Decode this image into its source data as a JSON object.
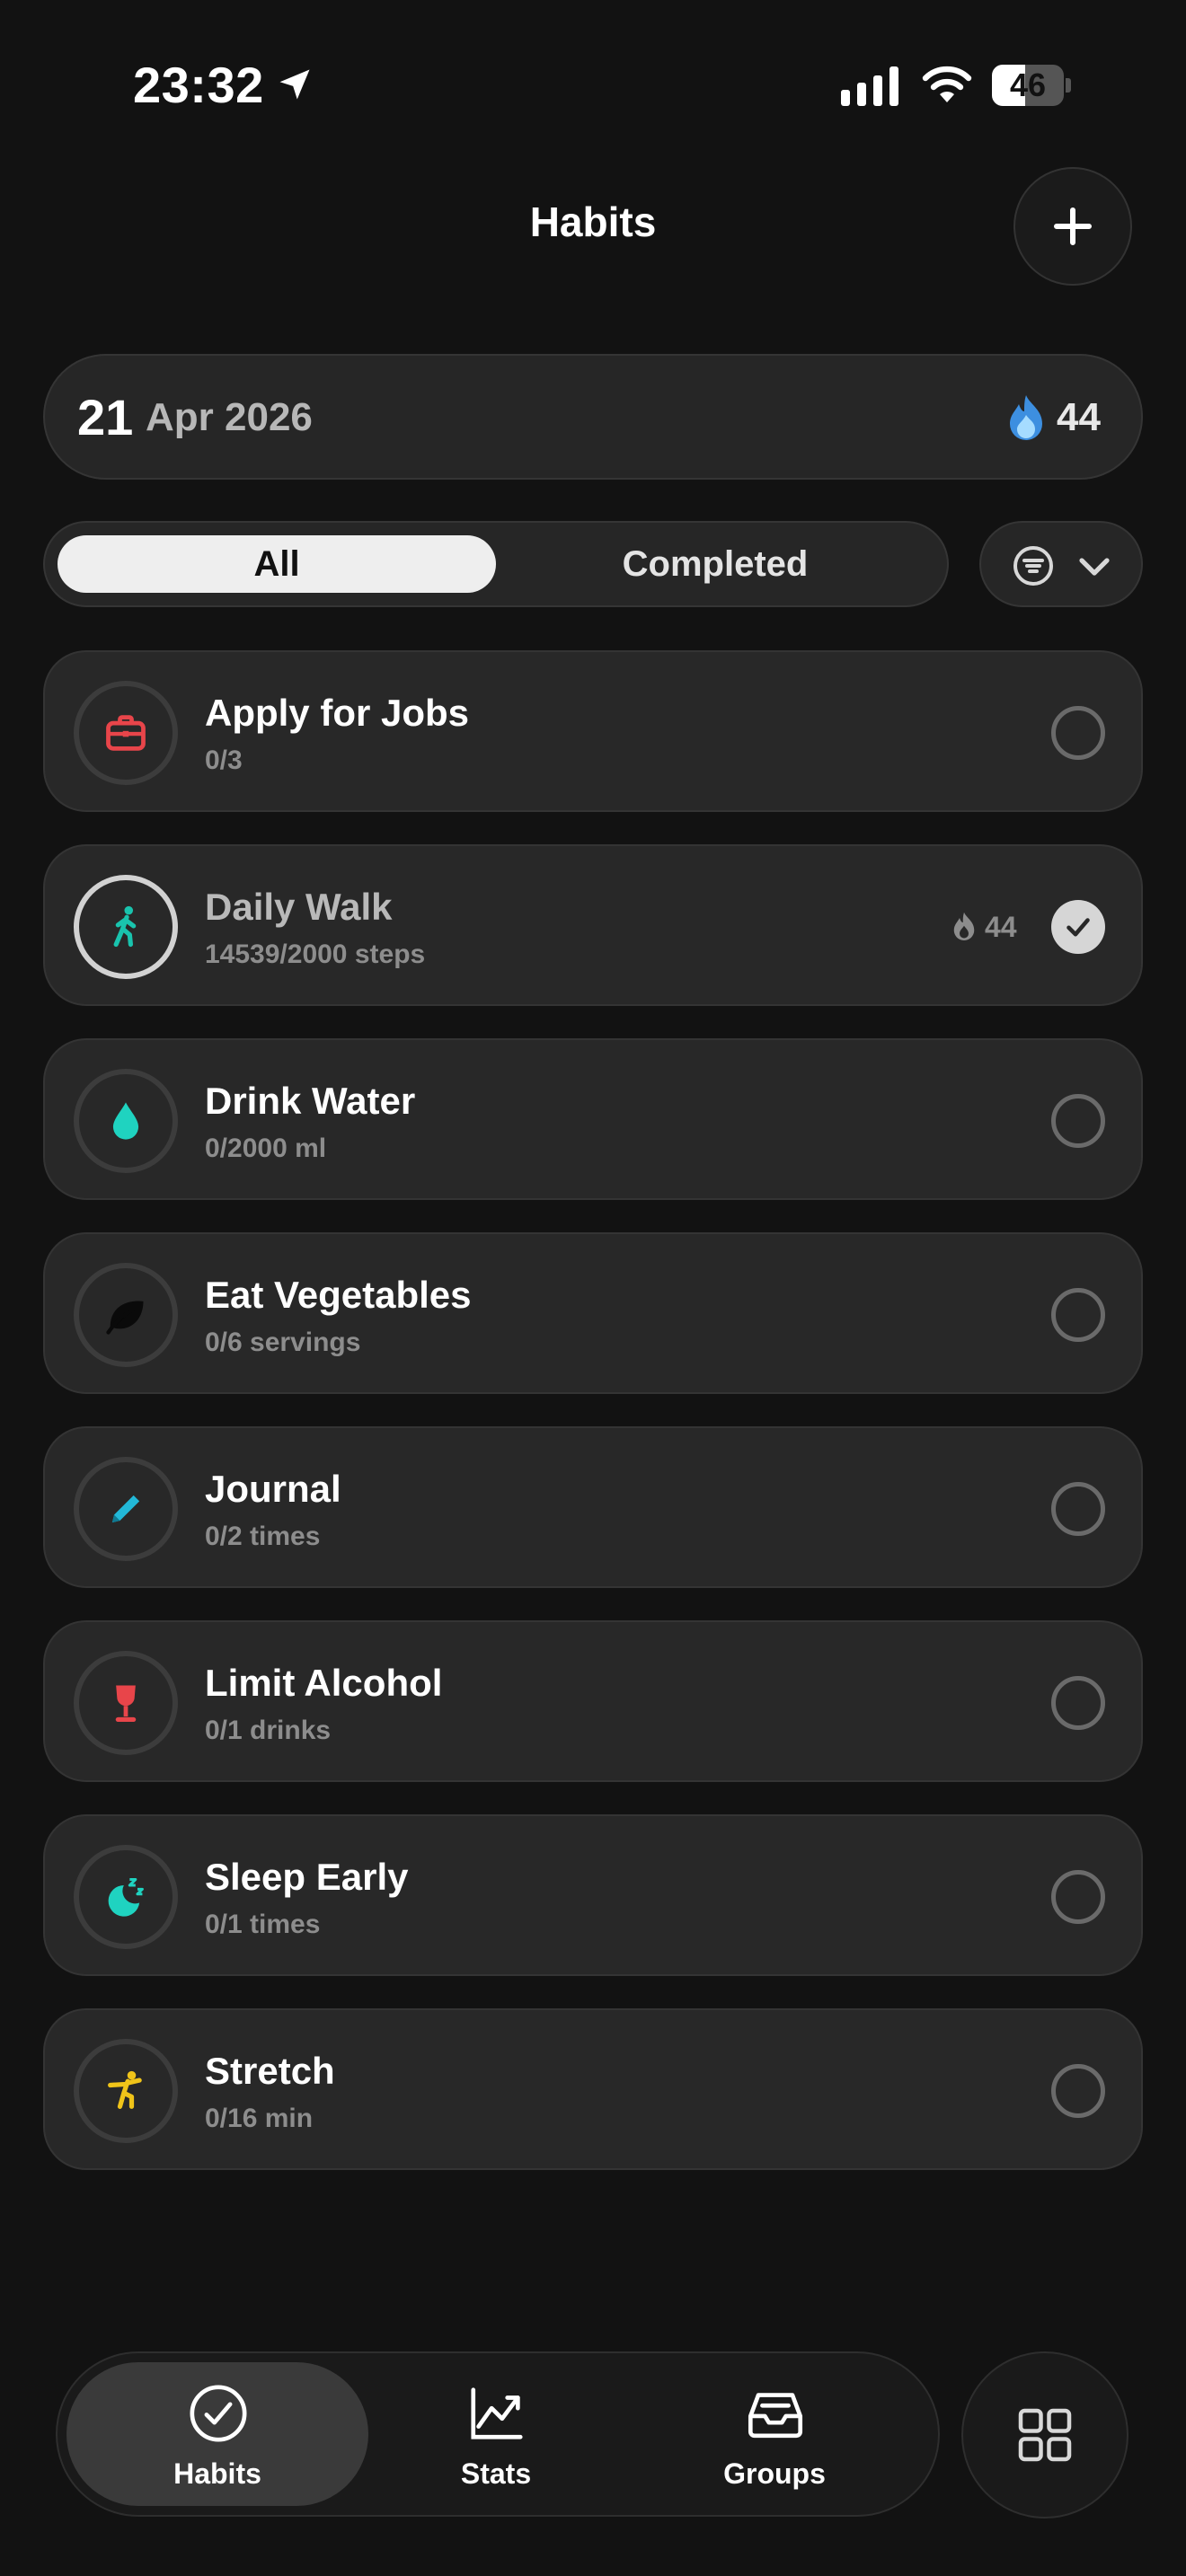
{
  "status_bar": {
    "time": "23:32",
    "battery_percent": "46",
    "battery_level": 0.46
  },
  "header": {
    "title": "Habits",
    "add_icon": "plus-icon"
  },
  "date_bar": {
    "day": "21",
    "month_year": "Apr 2026",
    "streak_icon": "flame-icon",
    "streak_count": "44"
  },
  "filter_tabs": {
    "options": [
      "All",
      "Completed"
    ],
    "selected": "All",
    "filter_icon": "filter-icon",
    "dropdown_icon": "chevron-down-icon"
  },
  "habits": [
    {
      "name": "Apply for Jobs",
      "progress": "0/3",
      "icon": "briefcase-icon",
      "icon_color": "#e8454a",
      "completed": false
    },
    {
      "name": "Daily Walk",
      "progress": "14539/2000 steps",
      "icon": "walking-icon",
      "icon_color": "#19c3ad",
      "completed": true,
      "streak": "44"
    },
    {
      "name": "Drink Water",
      "progress": "0/2000 ml",
      "icon": "water-drop-icon",
      "icon_color": "#1fd3c0",
      "completed": false
    },
    {
      "name": "Eat Vegetables",
      "progress": "0/6 servings",
      "icon": "leaf-icon",
      "icon_color": "#0a0a0a",
      "completed": false
    },
    {
      "name": "Journal",
      "progress": "0/2 times",
      "icon": "pencil-icon",
      "icon_color": "#22b8d8",
      "completed": false
    },
    {
      "name": "Limit Alcohol",
      "progress": "0/1 drinks",
      "icon": "wine-glass-icon",
      "icon_color": "#e8454a",
      "completed": false
    },
    {
      "name": "Sleep Early",
      "progress": "0/1 times",
      "icon": "moon-sleep-icon",
      "icon_color": "#1fd3c0",
      "completed": false
    },
    {
      "name": "Stretch",
      "progress": "0/16 min",
      "icon": "stretch-icon",
      "icon_color": "#f0c419",
      "completed": false
    }
  ],
  "tab_bar": {
    "tabs": [
      {
        "label": "Habits",
        "icon": "check-circle-icon",
        "active": true
      },
      {
        "label": "Stats",
        "icon": "chart-icon",
        "active": false
      },
      {
        "label": "Groups",
        "icon": "inbox-icon",
        "active": false
      }
    ],
    "more_icon": "grid-icon"
  }
}
